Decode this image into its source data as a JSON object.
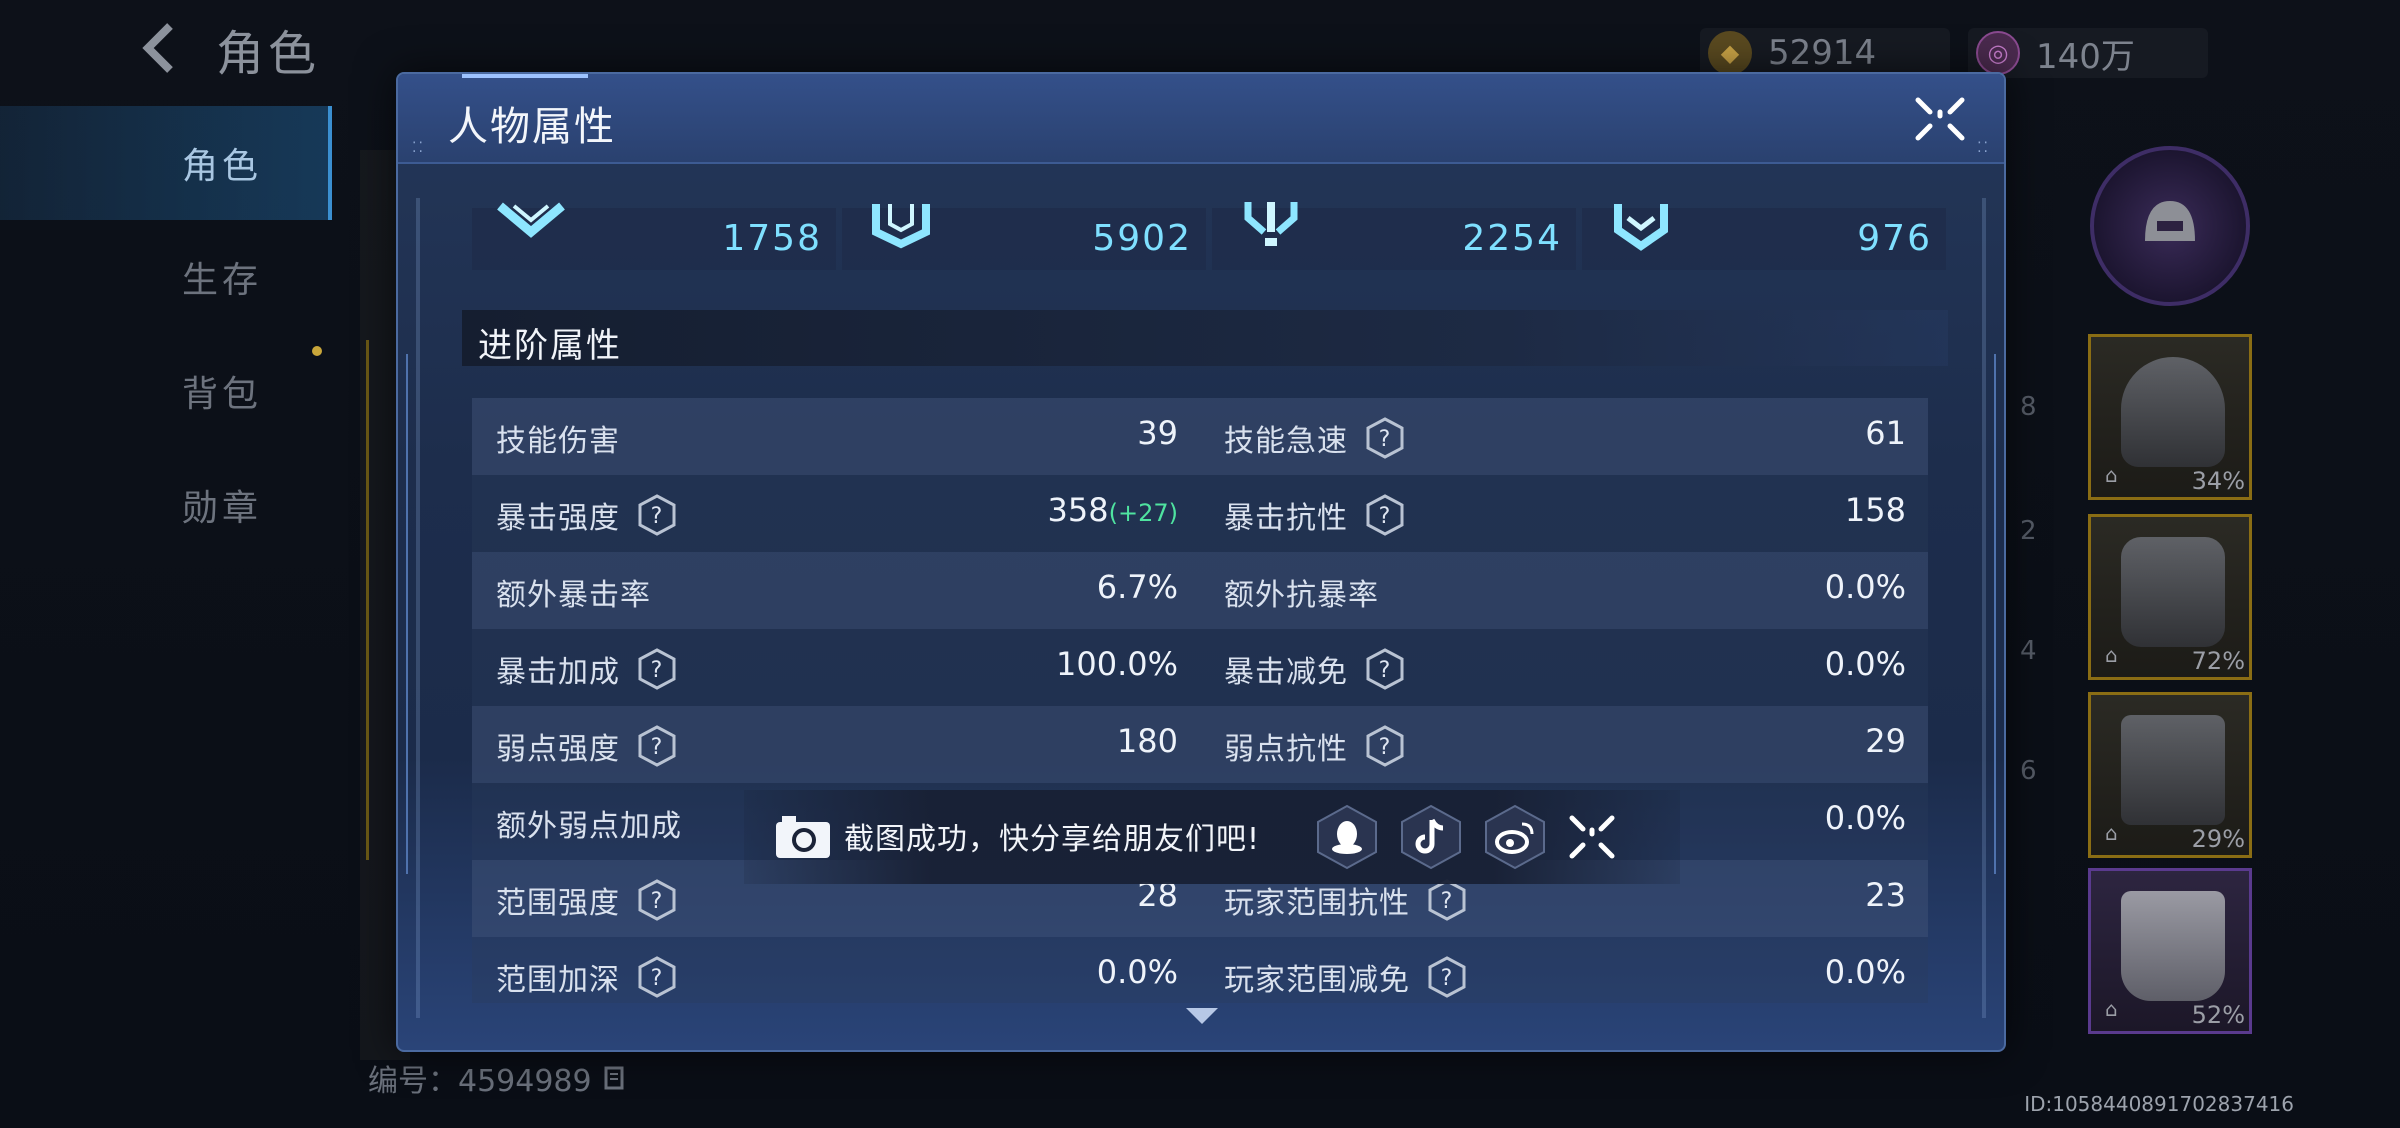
{
  "background": {
    "page_title": "角色",
    "currency_gold": "52914",
    "currency_gem": "140万",
    "nav": [
      {
        "label": "角色",
        "active": true
      },
      {
        "label": "生存",
        "active": false
      },
      {
        "label": "背包",
        "active": false
      },
      {
        "label": "勋章",
        "active": false
      }
    ],
    "serial_label": "编号：4594989",
    "device_id": "ID:1058440891702837416",
    "equipment": [
      {
        "percent": "34%"
      },
      {
        "percent": "72%"
      },
      {
        "percent": "29%"
      },
      {
        "percent": "52%"
      }
    ]
  },
  "modal": {
    "title": "人物属性",
    "basic_stats": [
      "1758",
      "5902",
      "2254",
      "976"
    ],
    "section_title": "进阶属性",
    "rows": [
      {
        "left": {
          "name": "技能伤害",
          "value": "39",
          "help": false
        },
        "right": {
          "name": "技能急速",
          "value": "61",
          "help": true
        }
      },
      {
        "left": {
          "name": "暴击强度",
          "value": "358",
          "bonus": "(+27)",
          "help": true
        },
        "right": {
          "name": "暴击抗性",
          "value": "158",
          "help": true
        }
      },
      {
        "left": {
          "name": "额外暴击率",
          "value": "6.7%",
          "help": false
        },
        "right": {
          "name": "额外抗暴率",
          "value": "0.0%",
          "help": false
        }
      },
      {
        "left": {
          "name": "暴击加成",
          "value": "100.0%",
          "help": true
        },
        "right": {
          "name": "暴击减免",
          "value": "0.0%",
          "help": true
        }
      },
      {
        "left": {
          "name": "弱点强度",
          "value": "180",
          "help": true
        },
        "right": {
          "name": "弱点抗性",
          "value": "29",
          "help": true
        }
      },
      {
        "left": {
          "name": "额外弱点加成",
          "value": "",
          "help": false
        },
        "right": {
          "name": "",
          "value": "0.0%",
          "help": false
        }
      },
      {
        "left": {
          "name": "范围强度",
          "value": "28",
          "help": true
        },
        "right": {
          "name": "玩家范围抗性",
          "value": "23",
          "help": true
        }
      },
      {
        "left": {
          "name": "范围加深",
          "value": "0.0%",
          "help": true
        },
        "right": {
          "name": "玩家范围减免",
          "value": "0.0%",
          "help": true
        }
      }
    ]
  },
  "toast": {
    "message": "截图成功，快分享给朋友们吧!",
    "share_targets": [
      "qq-icon",
      "tiktok-icon",
      "weibo-icon"
    ]
  },
  "colors": {
    "accent_cyan": "#7fe0ff",
    "bonus_green": "#4fe3a0",
    "modal_bg": "#1d2d4c"
  }
}
